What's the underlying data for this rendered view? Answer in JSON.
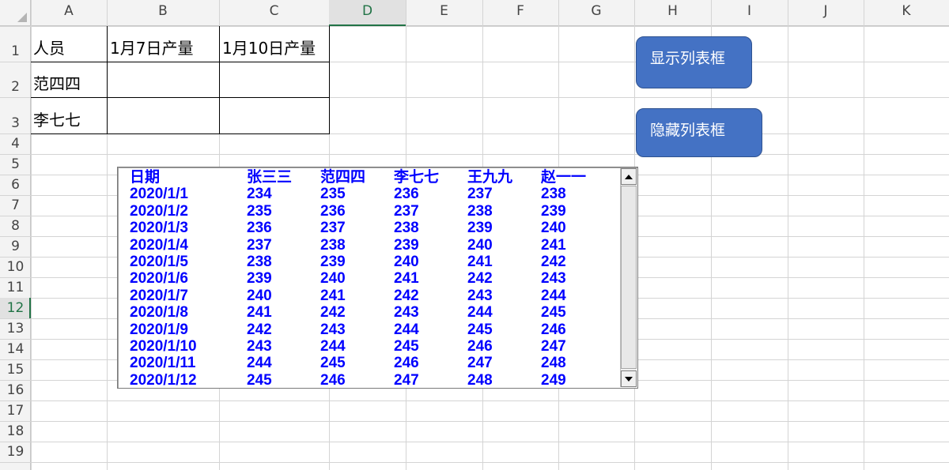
{
  "columns": [
    "A",
    "B",
    "C",
    "D",
    "E",
    "F",
    "G",
    "H",
    "I",
    "J",
    "K"
  ],
  "selected_column": "D",
  "rows": [
    "1",
    "2",
    "3",
    "4",
    "5",
    "6",
    "7",
    "8",
    "9",
    "10",
    "11",
    "12",
    "13",
    "14",
    "15",
    "16",
    "17",
    "18",
    "19"
  ],
  "selected_row": "12",
  "sheet_table": {
    "headers": [
      "人员",
      "1月7日产量",
      "1月10日产量"
    ],
    "rows": [
      [
        "范四四",
        "",
        ""
      ],
      [
        "李七七",
        "",
        ""
      ]
    ]
  },
  "buttons": {
    "show": "显示列表框",
    "hide": "隐藏列表框"
  },
  "listbox": {
    "headers": [
      "日期",
      "张三三",
      "范四四",
      "李七七",
      "王九九",
      "赵一一"
    ],
    "rows": [
      [
        "2020/1/1",
        "234",
        "235",
        "236",
        "237",
        "238"
      ],
      [
        "2020/1/2",
        "235",
        "236",
        "237",
        "238",
        "239"
      ],
      [
        "2020/1/3",
        "236",
        "237",
        "238",
        "239",
        "240"
      ],
      [
        "2020/1/4",
        "237",
        "238",
        "239",
        "240",
        "241"
      ],
      [
        "2020/1/5",
        "238",
        "239",
        "240",
        "241",
        "242"
      ],
      [
        "2020/1/6",
        "239",
        "240",
        "241",
        "242",
        "243"
      ],
      [
        "2020/1/7",
        "240",
        "241",
        "242",
        "243",
        "244"
      ],
      [
        "2020/1/8",
        "241",
        "242",
        "243",
        "244",
        "245"
      ],
      [
        "2020/1/9",
        "242",
        "243",
        "244",
        "245",
        "246"
      ],
      [
        "2020/1/10",
        "243",
        "244",
        "245",
        "246",
        "247"
      ],
      [
        "2020/1/11",
        "244",
        "245",
        "246",
        "247",
        "248"
      ],
      [
        "2020/1/12",
        "245",
        "246",
        "247",
        "248",
        "249"
      ]
    ],
    "text_color": "#0000ff"
  },
  "colors": {
    "accent": "#217346",
    "button_fill": "#4472c4"
  }
}
